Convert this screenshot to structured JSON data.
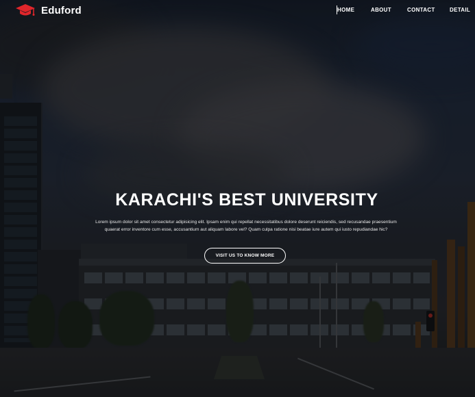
{
  "brand": {
    "name": "Eduford",
    "icon": "graduation-cap-icon",
    "icon_color": "#e0262b"
  },
  "nav": {
    "items": [
      {
        "label": "HOME"
      },
      {
        "label": "ABOUT"
      },
      {
        "label": "CONTACT"
      },
      {
        "label": "DETAIL"
      }
    ]
  },
  "hero": {
    "headline": "KARACHI'S BEST UNIVERSITY",
    "body": "Lorem ipsum dolor sit amet consectetur adipisicing elit. Ipsam enim qui repellat necessitatibus dolore deserunt reiciendis, sed recusandae praesentium quaerat error inventore cum esse, accusantium aut aliquam labore vel? Quam culpa ratione nisi beatae iure autem qui iusto repudiandae hic?",
    "cta_label": "VISIT US TO KNOW MORE"
  },
  "colors": {
    "accent": "#e0262b",
    "text": "#ffffff"
  }
}
